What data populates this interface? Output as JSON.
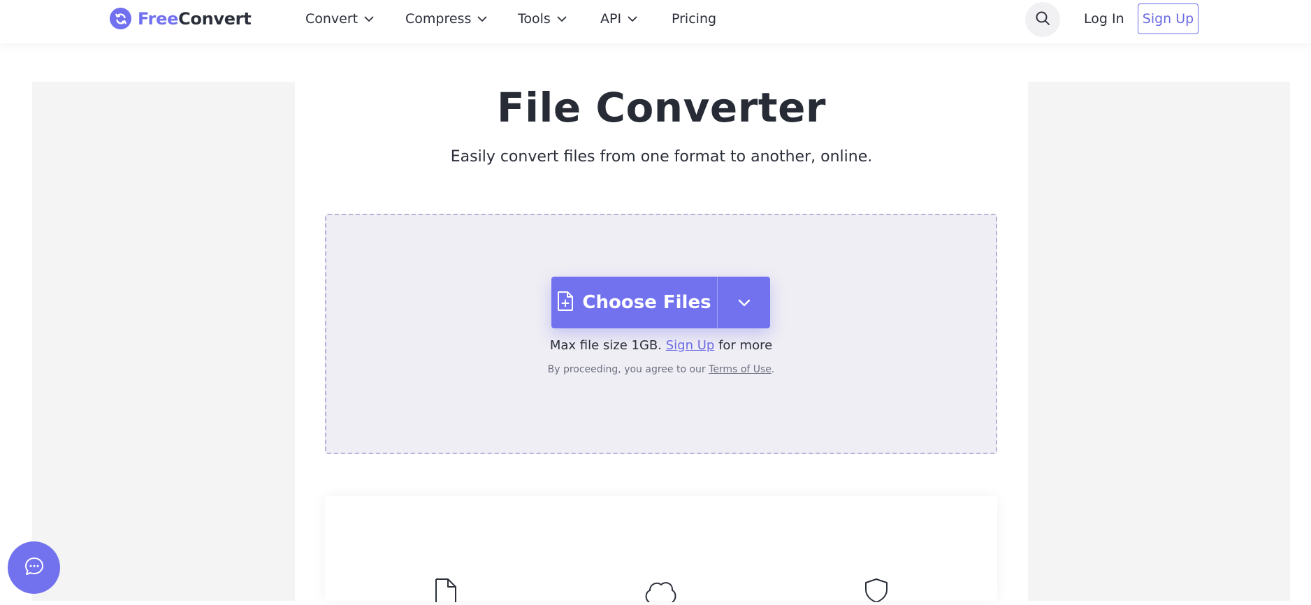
{
  "brand": {
    "free": "Free",
    "convert": "Convert",
    "accent": "#7272ef"
  },
  "nav": {
    "items": [
      {
        "label": "Convert",
        "has_dropdown": true
      },
      {
        "label": "Compress",
        "has_dropdown": true
      },
      {
        "label": "Tools",
        "has_dropdown": true
      },
      {
        "label": "API",
        "has_dropdown": true
      },
      {
        "label": "Pricing",
        "has_dropdown": false
      }
    ],
    "login_label": "Log In",
    "signup_label": "Sign Up",
    "search_icon": "search-icon"
  },
  "hero": {
    "title": "File Converter",
    "subtitle": "Easily convert files from one format to another, online."
  },
  "upload": {
    "choose_label": "Choose Files",
    "max_prefix": "Max file size 1GB.",
    "max_link": "Sign Up",
    "max_suffix": "for more",
    "terms_prefix": "By proceeding, you agree to our",
    "terms_link": "Terms of Use",
    "terms_suffix": "."
  },
  "features": {
    "icons": [
      "file-icon",
      "cloud-icon",
      "shield-icon"
    ]
  },
  "chat": {
    "icon": "chat-icon"
  }
}
